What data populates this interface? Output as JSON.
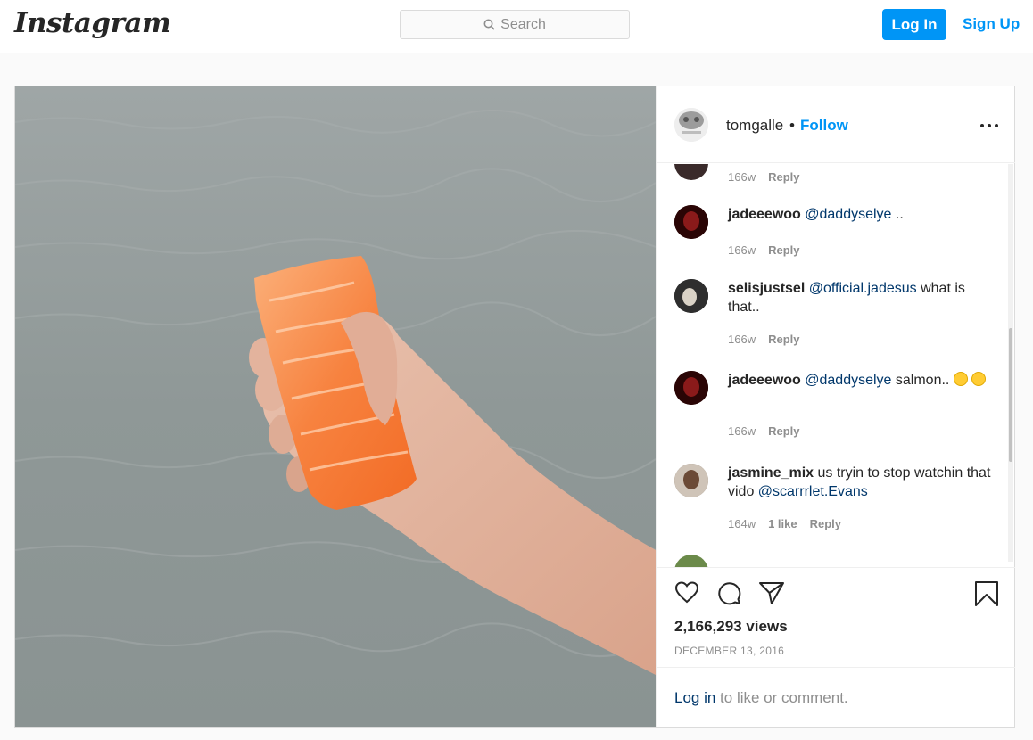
{
  "header": {
    "logo_text": "Instagram",
    "search_placeholder": "Search",
    "login_label": "Log In",
    "signup_label": "Sign Up"
  },
  "post": {
    "owner": "tomgalle",
    "separator": "•",
    "follow_label": "Follow",
    "comments": [
      {
        "user": "",
        "mention": "",
        "text": "",
        "time": "166w",
        "likes": "",
        "reply": "Reply"
      },
      {
        "user": "jadeeewoo",
        "mention": "@daddyselye",
        "text": " ..",
        "time": "166w",
        "likes": "",
        "reply": "Reply"
      },
      {
        "user": "selisjustsel",
        "mention": "@official.jadesus",
        "text": " what is that..",
        "time": "166w",
        "likes": "",
        "reply": "Reply"
      },
      {
        "user": "jadeeewoo",
        "mention": "@daddyselye",
        "text": " salmon..",
        "time": "166w",
        "likes": "",
        "reply": "Reply"
      },
      {
        "user": "jasmine_mix",
        "pre_text": " us tryin to stop watchin that vido ",
        "mention": "@scarrrlet.Evans",
        "time": "164w",
        "likes": "1 like",
        "reply": "Reply"
      }
    ],
    "views": "2,166,293 views",
    "date": "DECEMBER 13, 2016",
    "login_prompt": {
      "link": "Log in",
      "rest": " to like or comment."
    }
  },
  "colors": {
    "accent": "#0095f6",
    "mention": "#00376b",
    "muted": "#8e8e8e",
    "border": "#dbdbdb"
  },
  "icons": [
    "search-icon",
    "more-options-icon",
    "heart-icon",
    "comment-icon",
    "share-icon",
    "bookmark-icon",
    "ok-hand-emoji",
    "laughing-emoji"
  ]
}
